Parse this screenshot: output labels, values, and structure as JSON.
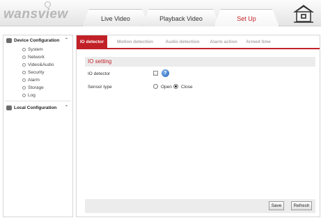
{
  "brand": {
    "logo_text": "wansview"
  },
  "nav": {
    "tabs": [
      {
        "label": "Live Video"
      },
      {
        "label": "Playback Video"
      },
      {
        "label": "Set Up"
      }
    ],
    "active_tab": "Set Up"
  },
  "sidebar": {
    "groups": [
      {
        "label": "Device Configuration",
        "expanded": true,
        "items": [
          "System",
          "Network",
          "Video&Audio",
          "Security",
          "Alarm",
          "Storage",
          "Log"
        ]
      },
      {
        "label": "Local Configuration",
        "expanded": false,
        "items": []
      }
    ]
  },
  "subtabs": [
    {
      "label": "IO detector"
    },
    {
      "label": "Motion detection"
    },
    {
      "label": "Audio detection"
    },
    {
      "label": "Alarm action"
    },
    {
      "label": "Armed time"
    }
  ],
  "active_subtab": "IO detector",
  "section": {
    "title": "IO setting"
  },
  "form": {
    "io_detector": {
      "label": "IO detector",
      "checked": false,
      "help": "?"
    },
    "sensor_type": {
      "label": "Sensor type",
      "options": [
        "Open",
        "Close"
      ],
      "selected": "Close"
    }
  },
  "buttons": {
    "save": "Save",
    "refresh": "Refresh"
  },
  "colors": {
    "accent": "#c22027",
    "panel_bg": "#ececec",
    "help_icon": "#2a63b8"
  },
  "icons": {
    "home": "home-icon",
    "help": "help-icon"
  }
}
